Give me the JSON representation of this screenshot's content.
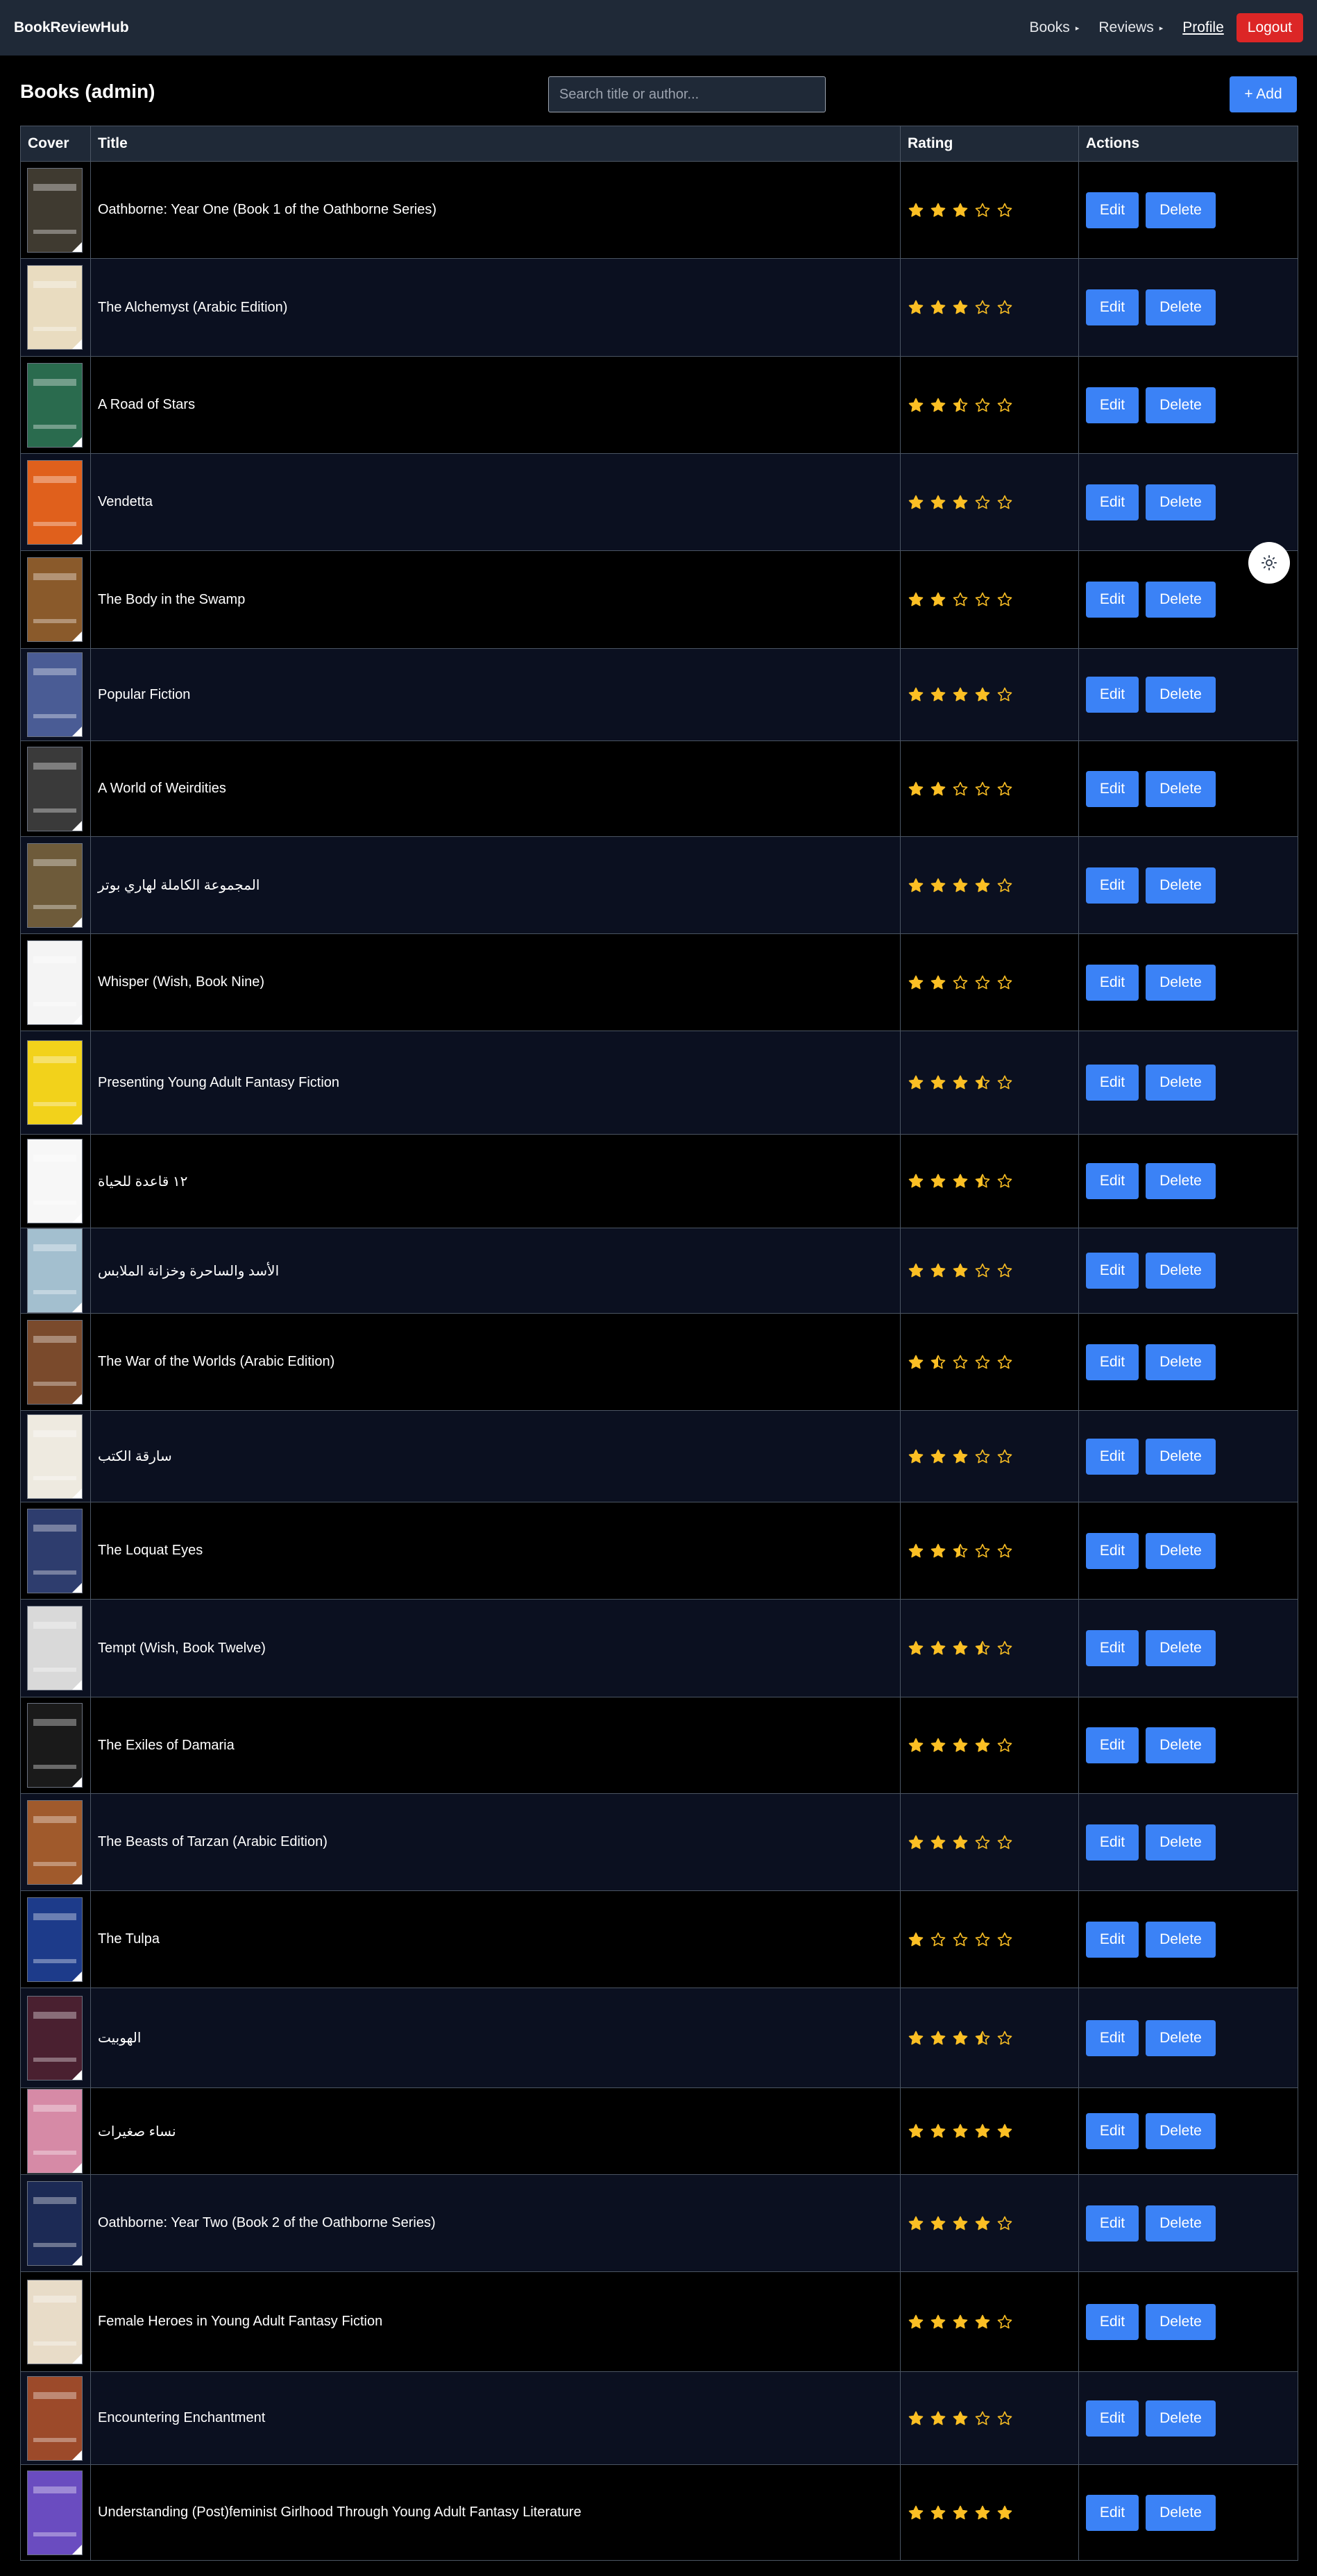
{
  "navbar": {
    "brand": "BookReviewHub",
    "books_label": "Books",
    "reviews_label": "Reviews",
    "profile_label": "Profile",
    "logout_label": "Logout"
  },
  "page": {
    "title": "Books (admin)",
    "search_placeholder": "Search title or author...",
    "add_label": "+ Add"
  },
  "table": {
    "columns": [
      "Cover",
      "Title",
      "Rating",
      "Actions"
    ],
    "edit_label": "Edit",
    "delete_label": "Delete",
    "rows": [
      {
        "title": "Oathborne: Year One (Book 1 of the Oathborne Series)",
        "rating": 3,
        "cover_color": "#3f3a30"
      },
      {
        "title": "The Alchemyst (Arabic Edition)",
        "rating": 3,
        "cover_color": "#e9dcc0"
      },
      {
        "title": "A Road of Stars",
        "rating": 2.5,
        "cover_color": "#2a6b4e"
      },
      {
        "title": "Vendetta",
        "rating": 3,
        "cover_color": "#e0601c"
      },
      {
        "title": "The Body in the Swamp",
        "rating": 2,
        "cover_color": "#8a5a2b"
      },
      {
        "title": "Popular Fiction",
        "rating": 4,
        "cover_color": "#4a5c95"
      },
      {
        "title": "A World of Weirdities",
        "rating": 2,
        "cover_color": "#3a3a3a"
      },
      {
        "title": "المجموعة الكاملة لهاري بوتر",
        "rating": 4,
        "cover_color": "#6e5b3a"
      },
      {
        "title": "Whisper (Wish, Book Nine)",
        "rating": 2,
        "cover_color": "#f4f4f4"
      },
      {
        "title": "Presenting Young Adult Fantasy Fiction",
        "rating": 3.5,
        "cover_color": "#f2d21b"
      },
      {
        "title": "١٢ قاعدة للحياة",
        "rating": 3.5,
        "cover_color": "#f7f7f7"
      },
      {
        "title": "الأسد والساحرة وخزانة الملابس",
        "rating": 3,
        "cover_color": "#a3bfcf"
      },
      {
        "title": "The War of the Worlds (Arabic Edition)",
        "rating": 1.5,
        "cover_color": "#7a4a2c"
      },
      {
        "title": "سارقة الكتب",
        "rating": 3,
        "cover_color": "#eeeae0"
      },
      {
        "title": "The Loquat Eyes",
        "rating": 2.5,
        "cover_color": "#2e3d6e"
      },
      {
        "title": "Tempt (Wish, Book Twelve)",
        "rating": 3.5,
        "cover_color": "#d9d9d9"
      },
      {
        "title": "The Exiles of Damaria",
        "rating": 4,
        "cover_color": "#1a1a1a"
      },
      {
        "title": "The Beasts of Tarzan (Arabic Edition)",
        "rating": 3,
        "cover_color": "#a05a2c"
      },
      {
        "title": "The Tulpa",
        "rating": 1,
        "cover_color": "#1d3b8a"
      },
      {
        "title": "الهوبيت",
        "rating": 3.5,
        "cover_color": "#4a2030"
      },
      {
        "title": "نساء صغيرات",
        "rating": 5,
        "cover_color": "#d68aa6"
      },
      {
        "title": "Oathborne: Year Two (Book 2 of the Oathborne Series)",
        "rating": 4,
        "cover_color": "#1c2a55"
      },
      {
        "title": "Female Heroes in Young Adult Fantasy Fiction",
        "rating": 4,
        "cover_color": "#e8dcc8"
      },
      {
        "title": "Encountering Enchantment",
        "rating": 3,
        "cover_color": "#9c4a2a"
      },
      {
        "title": "Understanding (Post)feminist Girlhood Through Young Adult Fantasy Literature",
        "rating": 5,
        "cover_color": "#6a4cc0"
      }
    ]
  },
  "colors": {
    "star": "#fbbf24",
    "primary": "#3b82f6",
    "danger": "#dc2626",
    "navbar": "#1f2937"
  },
  "icons": {
    "theme_toggle": "sun-icon"
  }
}
